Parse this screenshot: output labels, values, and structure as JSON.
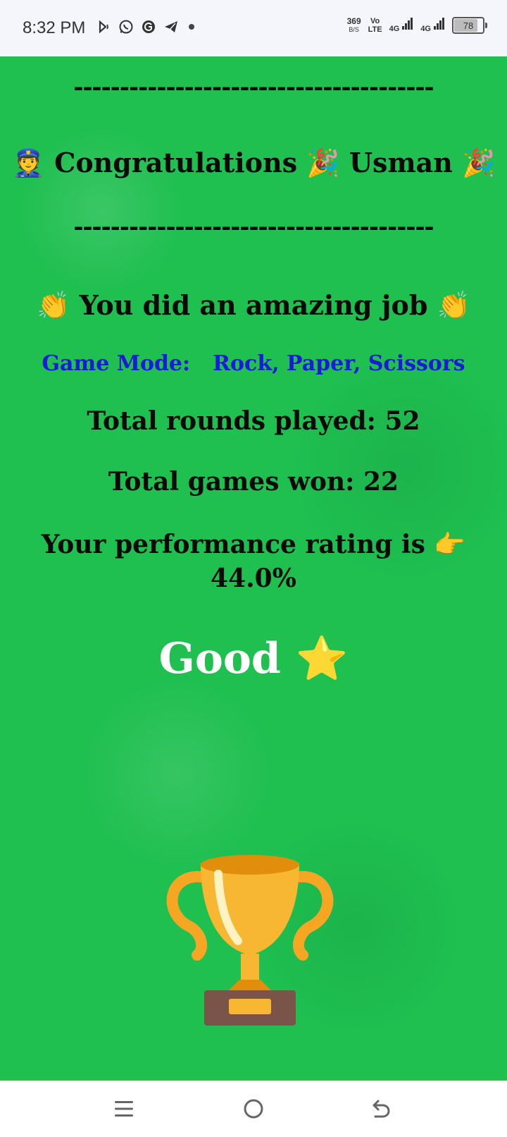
{
  "status_bar": {
    "time": "8:32 PM",
    "network_speed": "369",
    "network_speed_unit": "B/S",
    "volte_top": "Vo",
    "volte_bottom": "LTE",
    "sim1_label": "4G",
    "sim2_label": "4G",
    "battery_level": "78",
    "icons": [
      "bluetooth-audio-icon",
      "whatsapp-icon",
      "grammarly-icon",
      "telegram-icon",
      "notification-dot-icon"
    ]
  },
  "result": {
    "divider": "---------------------------------------",
    "congrats_emoji_left": "👮",
    "congrats_text": "Congratulations",
    "party_emoji": "🎉",
    "player_name": "Usman",
    "clap_emoji": "👏",
    "praise_text": "You did an amazing job",
    "game_mode_label": "Game Mode:",
    "game_mode_value": "Rock, Paper, Scissors",
    "rounds_label": "Total rounds played: 52",
    "won_label": "Total games won: 22",
    "rating_label": "Your performance rating is",
    "pointing_emoji": "👉",
    "rating_value": "44.0%",
    "grade_text": "Good",
    "star_emoji": "⭐"
  },
  "colors": {
    "background_green": "#1fbf50",
    "game_mode_blue": "#1a1ad8",
    "grade_white": "#ffffff"
  },
  "nav_bar": {
    "icons": [
      "menu-icon",
      "home-icon",
      "back-icon"
    ]
  }
}
